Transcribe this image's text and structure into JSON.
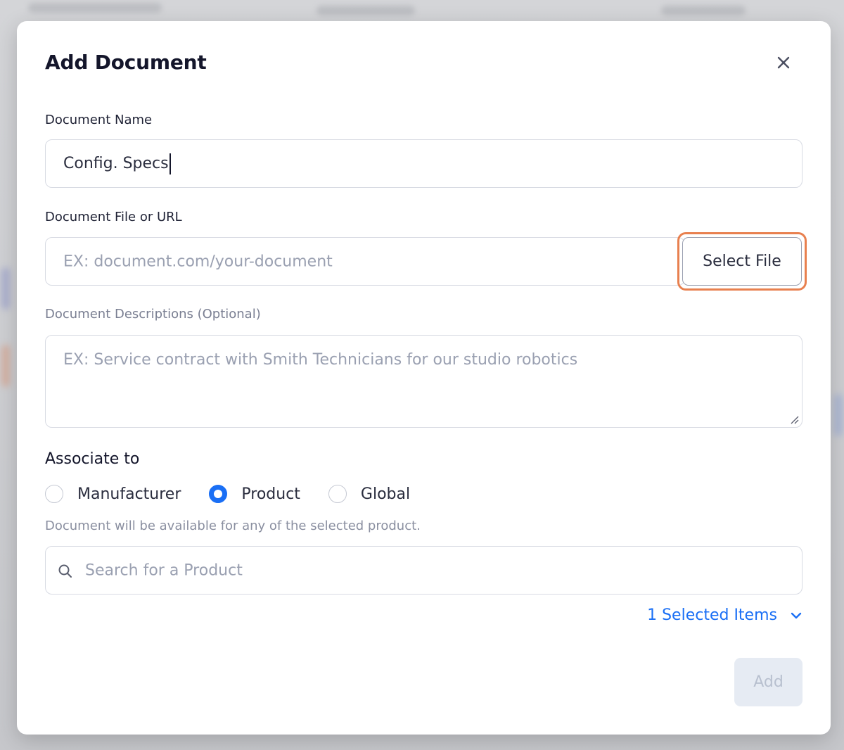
{
  "modal": {
    "title": "Add Document"
  },
  "document_name": {
    "label": "Document Name",
    "value": "Config. Specs"
  },
  "document_file": {
    "label": "Document File or URL",
    "placeholder": "EX: document.com/your-document",
    "select_file_label": "Select File"
  },
  "description": {
    "label": "Document Descriptions (Optional)",
    "placeholder": "EX: Service contract with Smith Technicians for our studio robotics"
  },
  "associate": {
    "title": "Associate to",
    "options": [
      {
        "label": "Manufacturer",
        "checked": false
      },
      {
        "label": "Product",
        "checked": true
      },
      {
        "label": "Global",
        "checked": false
      }
    ],
    "helper": "Document will be available for any of the selected product."
  },
  "search": {
    "placeholder": "Search for a Product"
  },
  "selection": {
    "summary": "1 Selected Items"
  },
  "actions": {
    "add_label": "Add"
  },
  "colors": {
    "accent": "#1a6ff5",
    "highlight": "#e8804f"
  },
  "icons": {
    "close": "close-icon",
    "search": "search-icon",
    "chevron": "chevron-down-icon"
  }
}
